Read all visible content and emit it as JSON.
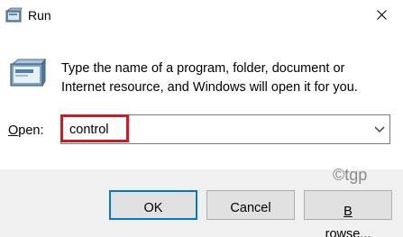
{
  "window": {
    "title": "Run",
    "close_icon": "close-icon"
  },
  "body": {
    "icon": "run-icon",
    "description_line1": "Type the name of a program, folder, document or",
    "description_line2": "Internet resource, and Windows will open it for you.",
    "open_label_mnemonic": "O",
    "open_label_rest": "pen:",
    "open_value": "control",
    "dropdown_icon": "chevron-down-icon"
  },
  "buttons": {
    "ok": "OK",
    "cancel": "Cancel",
    "browse_mnemonic": "B",
    "browse_rest": "rowse..."
  },
  "watermark": "©tgp",
  "colors": {
    "highlight": "#e0121b",
    "default_button_border": "#0078d7",
    "footer_bg": "#f0f0f0"
  }
}
